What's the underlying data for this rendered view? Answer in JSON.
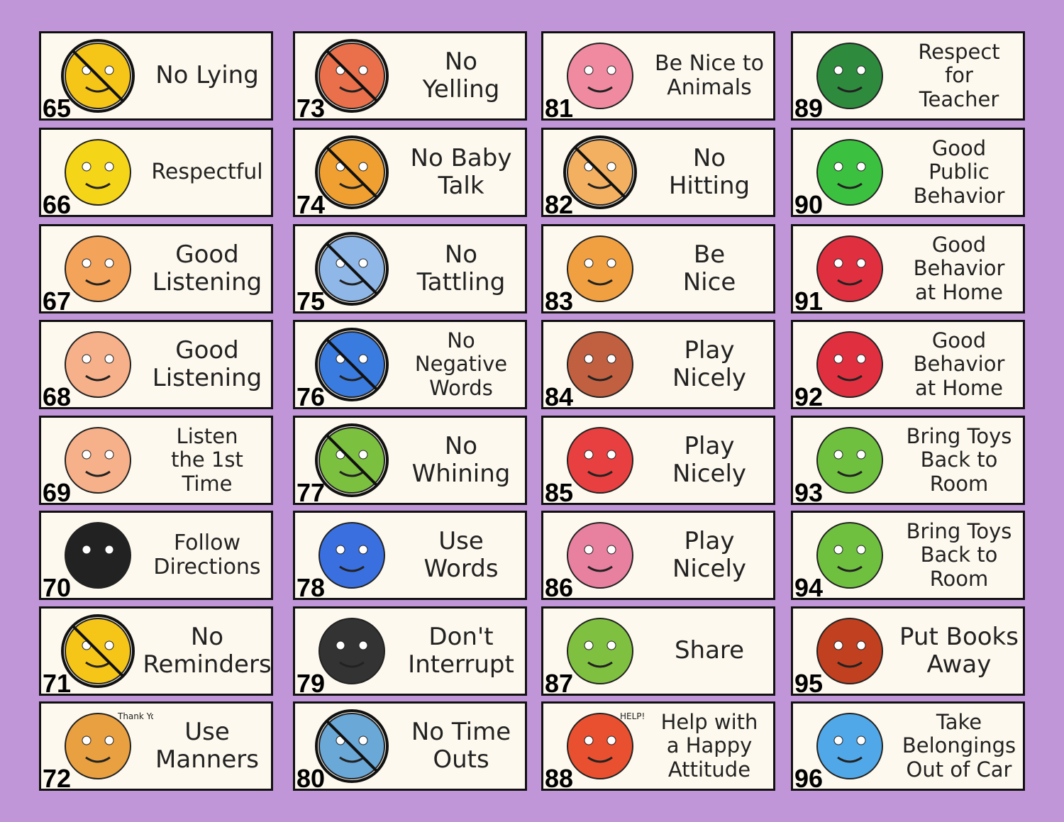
{
  "colors": {
    "background": "#C196D8",
    "card": "#FDF9EE",
    "border": "#111111",
    "prohibit": "#D0202A"
  },
  "cards": [
    {
      "number": "65",
      "lines": [
        "No Lying"
      ],
      "icon": "lying-face-icon",
      "color": "#F5C518",
      "prohibited": true
    },
    {
      "number": "66",
      "lines": [
        "Respectful"
      ],
      "icon": "smiley-face-icon",
      "color": "#F5D518",
      "prohibited": false
    },
    {
      "number": "67",
      "lines": [
        "Good",
        "Listening"
      ],
      "icon": "girl-ear-icon",
      "color": "#F3A35A",
      "prohibited": false
    },
    {
      "number": "68",
      "lines": [
        "Good",
        "Listening"
      ],
      "icon": "boy-ear-icon",
      "color": "#F6B08A",
      "prohibited": false
    },
    {
      "number": "69",
      "lines": [
        "Listen",
        "the 1st",
        "Time"
      ],
      "icon": "boy-number-one-icon",
      "color": "#F6B08A",
      "prohibited": false
    },
    {
      "number": "70",
      "lines": [
        "Follow",
        "Directions"
      ],
      "icon": "arrow-figures-icon",
      "color": "#222222",
      "prohibited": false
    },
    {
      "number": "71",
      "lines": [
        "No",
        "Reminders"
      ],
      "icon": "dont-forget-icon",
      "color": "#F5C518",
      "prohibited": true
    },
    {
      "number": "72",
      "lines": [
        "Use",
        "Manners"
      ],
      "icon": "thank-you-girl-icon",
      "color": "#E8A040",
      "prohibited": false,
      "note": "Thank You"
    },
    {
      "number": "73",
      "lines": [
        "No",
        "Yelling"
      ],
      "icon": "yelling-girl-icon",
      "color": "#E9704A",
      "prohibited": true
    },
    {
      "number": "74",
      "lines": [
        "No Baby",
        "Talk"
      ],
      "icon": "baby-talk-icon",
      "color": "#F0A030",
      "prohibited": true
    },
    {
      "number": "75",
      "lines": [
        "No",
        "Tattling"
      ],
      "icon": "tattling-girl-icon",
      "color": "#8FB8E8",
      "prohibited": true
    },
    {
      "number": "76",
      "lines": [
        "No",
        "Negative",
        "Words"
      ],
      "icon": "negative-bubbles-icon",
      "color": "#3A7BE0",
      "prohibited": true
    },
    {
      "number": "77",
      "lines": [
        "No",
        "Whining"
      ],
      "icon": "whining-child-icon",
      "color": "#7CC040",
      "prohibited": true
    },
    {
      "number": "78",
      "lines": [
        "Use",
        "Words"
      ],
      "icon": "speech-bubbles-icon",
      "color": "#3A6FE0",
      "prohibited": false
    },
    {
      "number": "79",
      "lines": [
        "Don't",
        "Interrupt"
      ],
      "icon": "chalkboard-kids-icon",
      "color": "#333333",
      "prohibited": false
    },
    {
      "number": "80",
      "lines": [
        "No Time",
        "Outs"
      ],
      "icon": "stopwatch-icon",
      "color": "#6AA8D8",
      "prohibited": true
    },
    {
      "number": "81",
      "lines": [
        "Be Nice to",
        "Animals"
      ],
      "icon": "girl-cat-icon",
      "color": "#F08AA0",
      "prohibited": false
    },
    {
      "number": "82",
      "lines": [
        "No",
        "Hitting"
      ],
      "icon": "fighting-kids-icon",
      "color": "#F3B060",
      "prohibited": true
    },
    {
      "number": "83",
      "lines": [
        "Be",
        "Nice"
      ],
      "icon": "hugging-kids-icon",
      "color": "#F0A040",
      "prohibited": false
    },
    {
      "number": "84",
      "lines": [
        "Play",
        "Nicely"
      ],
      "icon": "seesaw-kids-icon",
      "color": "#C06040",
      "prohibited": false
    },
    {
      "number": "85",
      "lines": [
        "Play",
        "Nicely"
      ],
      "icon": "blocks-kids-icon",
      "color": "#E84040",
      "prohibited": false
    },
    {
      "number": "86",
      "lines": [
        "Play",
        "Nicely"
      ],
      "icon": "tea-party-icon",
      "color": "#E880A0",
      "prohibited": false
    },
    {
      "number": "87",
      "lines": [
        "Share"
      ],
      "icon": "sharing-kids-icon",
      "color": "#80C040",
      "prohibited": false
    },
    {
      "number": "88",
      "lines": [
        "Help with",
        "a Happy",
        "Attitude"
      ],
      "icon": "help-sign-girl-icon",
      "color": "#E85030",
      "prohibited": false,
      "note": "HELP!"
    },
    {
      "number": "89",
      "lines": [
        "Respect",
        "for",
        "Teacher"
      ],
      "icon": "teacher-classroom-icon",
      "color": "#2E8B3E",
      "prohibited": false
    },
    {
      "number": "90",
      "lines": [
        "Good",
        "Public",
        "Behavior"
      ],
      "icon": "store-icon",
      "color": "#3CC040",
      "prohibited": false
    },
    {
      "number": "91",
      "lines": [
        "Good",
        "Behavior",
        "at Home"
      ],
      "icon": "red-house-icon",
      "color": "#E03040",
      "prohibited": false
    },
    {
      "number": "92",
      "lines": [
        "Good",
        "Behavior",
        "at Home"
      ],
      "icon": "red-house-icon",
      "color": "#E03040",
      "prohibited": false
    },
    {
      "number": "93",
      "lines": [
        "Bring Toys",
        "Back to",
        "Room"
      ],
      "icon": "boy-toy-basket-icon",
      "color": "#70C040",
      "prohibited": false
    },
    {
      "number": "94",
      "lines": [
        "Bring Toys",
        "Back to",
        "Room"
      ],
      "icon": "girl-toy-basket-icon",
      "color": "#70C040",
      "prohibited": false
    },
    {
      "number": "95",
      "lines": [
        "Put Books",
        "Away"
      ],
      "icon": "bookshelf-icon",
      "color": "#C04020",
      "prohibited": false
    },
    {
      "number": "96",
      "lines": [
        "Take",
        "Belongings",
        "Out of Car"
      ],
      "icon": "girl-car-icon",
      "color": "#50A8E8",
      "prohibited": false
    }
  ]
}
